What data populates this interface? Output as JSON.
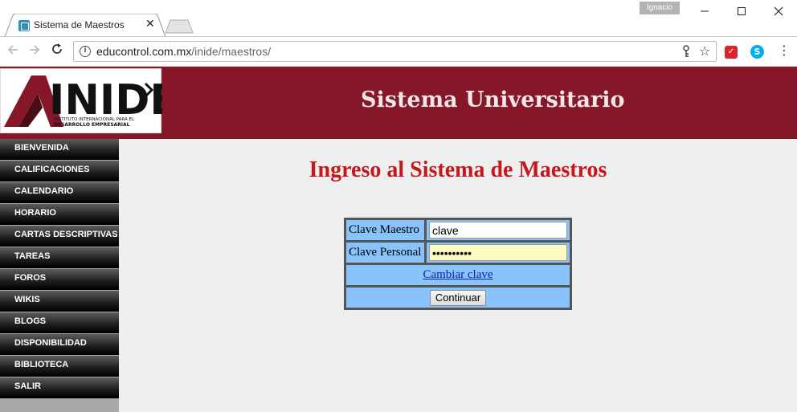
{
  "browser": {
    "tab_title": "Sistema de Maestros",
    "tab_close": "✕",
    "user_badge": "Ignacio",
    "url_host": "educontrol.com.mx",
    "url_path": "/inide/maestros/"
  },
  "header": {
    "logo_text": "INIDE",
    "logo_sub1": "INSTITUTO INTERNACIONAL PARA EL",
    "logo_sub2": "DESARROLLO EMPRESARIAL",
    "title": "Sistema Universitario"
  },
  "sidebar": {
    "items": [
      {
        "label": "BIENVENIDA"
      },
      {
        "label": "CALIFICACIONES"
      },
      {
        "label": "CALENDARIO"
      },
      {
        "label": "HORARIO"
      },
      {
        "label": "CARTAS DESCRIPTIVAS"
      },
      {
        "label": "TAREAS"
      },
      {
        "label": "FOROS"
      },
      {
        "label": "WIKIS"
      },
      {
        "label": "BLOGS"
      },
      {
        "label": "DISPONIBILIDAD"
      },
      {
        "label": "BIBLIOTECA"
      },
      {
        "label": "SALIR"
      }
    ]
  },
  "main": {
    "heading": "Ingreso al Sistema de Maestros",
    "form": {
      "clave_maestro_label": "Clave Maestro",
      "clave_maestro_value": "clave",
      "clave_personal_label": "Clave Personal",
      "clave_personal_value": "••••••••••",
      "change_link": "Cambiar clave",
      "submit_label": "Continuar"
    }
  },
  "colors": {
    "header_bg": "#851728",
    "heading": "#c8161d",
    "form_bg": "#88c3fb"
  }
}
